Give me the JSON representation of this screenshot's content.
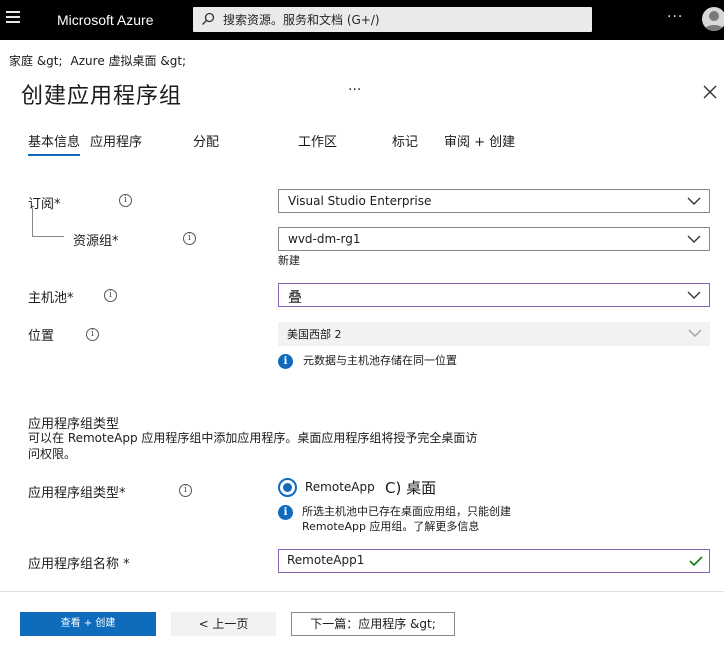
{
  "topbar": {
    "brand": "Microsoft Azure",
    "search_placeholder": "搜索资源。服务和文档 (G+/)",
    "more": "···"
  },
  "breadcrumb": [
    "家庭 &gt;",
    "Azure 虚拟桌面 &gt;"
  ],
  "page": {
    "title": "创建应用程序组",
    "title_more": "···"
  },
  "tabs": [
    {
      "label": "基本信息",
      "active": true
    },
    {
      "label": "应用程序"
    },
    {
      "label": "分配"
    },
    {
      "label": "工作区"
    },
    {
      "label": "标记"
    },
    {
      "label": "审阅 + 创建"
    }
  ],
  "form": {
    "subscription": {
      "label": "订阅*",
      "value": "Visual Studio Enterprise"
    },
    "resource_group": {
      "label": "资源组*",
      "value": "wvd-dm-rg1",
      "new_link": "新建"
    },
    "host_pool": {
      "label": "主机池*",
      "value": "叠"
    },
    "location": {
      "label": "位置",
      "value": "美国西部 2",
      "note": "元数据与主机池存储在同一位置"
    },
    "group_type_section": {
      "title": "应用程序组类型",
      "desc": "可以在 RemoteApp 应用程序组中添加应用程序。桌面应用程序组将授予完全桌面访问权限。"
    },
    "group_type": {
      "label": "应用程序组类型*",
      "selected": "RemoteApp",
      "other": "C) 桌面",
      "note": "所选主机池中已存在桌面应用组，只能创建 RemoteApp 应用组。了解更多信息"
    },
    "group_name": {
      "label": "应用程序组名称 *",
      "value": "RemoteApp1"
    }
  },
  "footer": {
    "review_create": "查看 + 创建",
    "previous": "< 上一页",
    "next": "下一篇：应用程序 &gt;"
  },
  "colors": {
    "accent": "#0f6cbd",
    "focus": "#8764b8",
    "success": "#107c10"
  },
  "icons": [
    "menu-icon",
    "search-icon",
    "info-icon",
    "close-icon",
    "chevron-down-icon",
    "check-icon",
    "avatar-icon"
  ]
}
